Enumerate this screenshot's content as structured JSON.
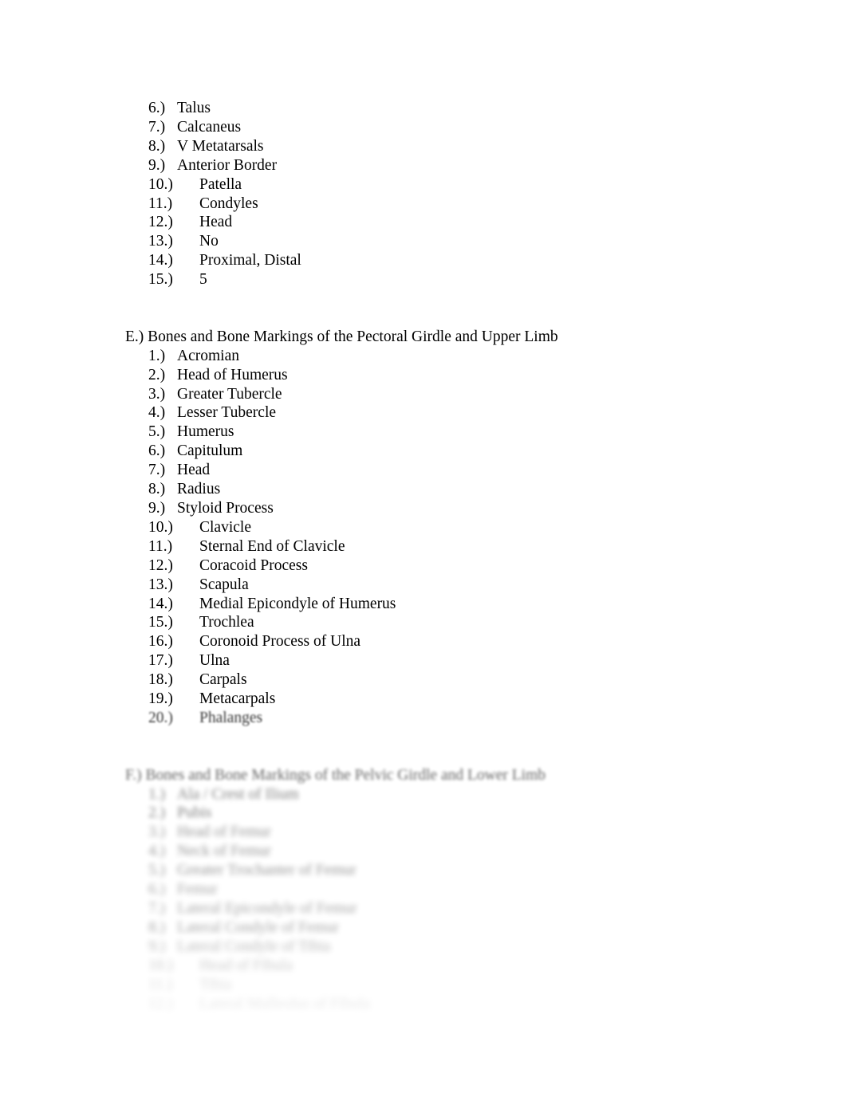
{
  "document": {
    "page_background": "#ffffff",
    "text_color": "#000000"
  },
  "sections": [
    {
      "id": "section-d-continued",
      "heading": null,
      "items": [
        {
          "num": "6.)",
          "label": "Talus"
        },
        {
          "num": "7.)",
          "label": "Calcaneus"
        },
        {
          "num": "8.)",
          "label": "V Metatarsals"
        },
        {
          "num": "9.)",
          "label": "Anterior Border"
        },
        {
          "num": "10.)",
          "label": "Patella"
        },
        {
          "num": "11.)",
          "label": "Condyles"
        },
        {
          "num": "12.)",
          "label": "Head"
        },
        {
          "num": "13.)",
          "label": "No"
        },
        {
          "num": "14.)",
          "label": "Proximal, Distal"
        },
        {
          "num": "15.)",
          "label": "5"
        }
      ]
    },
    {
      "id": "section-e",
      "heading": "E.) Bones and Bone Markings of the Pectoral Girdle and Upper Limb",
      "items": [
        {
          "num": "1.)",
          "label": "Acromian"
        },
        {
          "num": "2.)",
          "label": "Head of Humerus"
        },
        {
          "num": "3.)",
          "label": "Greater Tubercle"
        },
        {
          "num": "4.)",
          "label": "Lesser Tubercle"
        },
        {
          "num": "5.)",
          "label": "Humerus"
        },
        {
          "num": "6.)",
          "label": "Capitulum"
        },
        {
          "num": "7.)",
          "label": "Head"
        },
        {
          "num": "8.)",
          "label": "Radius"
        },
        {
          "num": "9.)",
          "label": "Styloid Process"
        },
        {
          "num": "10.)",
          "label": "Clavicle"
        },
        {
          "num": "11.)",
          "label": "Sternal End of Clavicle"
        },
        {
          "num": "12.)",
          "label": "Coracoid Process"
        },
        {
          "num": "13.)",
          "label": "Scapula"
        },
        {
          "num": "14.)",
          "label": "Medial Epicondyle of Humerus"
        },
        {
          "num": "15.)",
          "label": "Trochlea"
        },
        {
          "num": "16.)",
          "label": "Coronoid Process of Ulna"
        },
        {
          "num": "17.)",
          "label": "Ulna"
        },
        {
          "num": "18.)",
          "label": "Carpals"
        },
        {
          "num": "19.)",
          "label": "Metacarpals"
        },
        {
          "num": "20.)",
          "label": "Phalanges"
        }
      ]
    },
    {
      "id": "section-f",
      "heading": "F.) Bones and Bone Markings of the Pelvic Girdle and Lower Limb",
      "items": [
        {
          "num": "1.)",
          "label": "Ala / Crest of Ilium"
        },
        {
          "num": "2.)",
          "label": "Pubis"
        },
        {
          "num": "3.)",
          "label": "Head of Femur"
        },
        {
          "num": "4.)",
          "label": "Neck of Femur"
        },
        {
          "num": "5.)",
          "label": "Greater Trochanter of Femur"
        },
        {
          "num": "6.)",
          "label": "Femur"
        },
        {
          "num": "7.)",
          "label": "Lateral Epicondyle of Femur"
        },
        {
          "num": "8.)",
          "label": "Lateral Condyle of Femur"
        },
        {
          "num": "9.)",
          "label": "Lateral Condyle of Tibia"
        },
        {
          "num": "10.)",
          "label": "Head of Fibula"
        },
        {
          "num": "11.)",
          "label": "Tibia"
        },
        {
          "num": "12.)",
          "label": "Lateral Malleolus of Fibula"
        }
      ]
    }
  ]
}
